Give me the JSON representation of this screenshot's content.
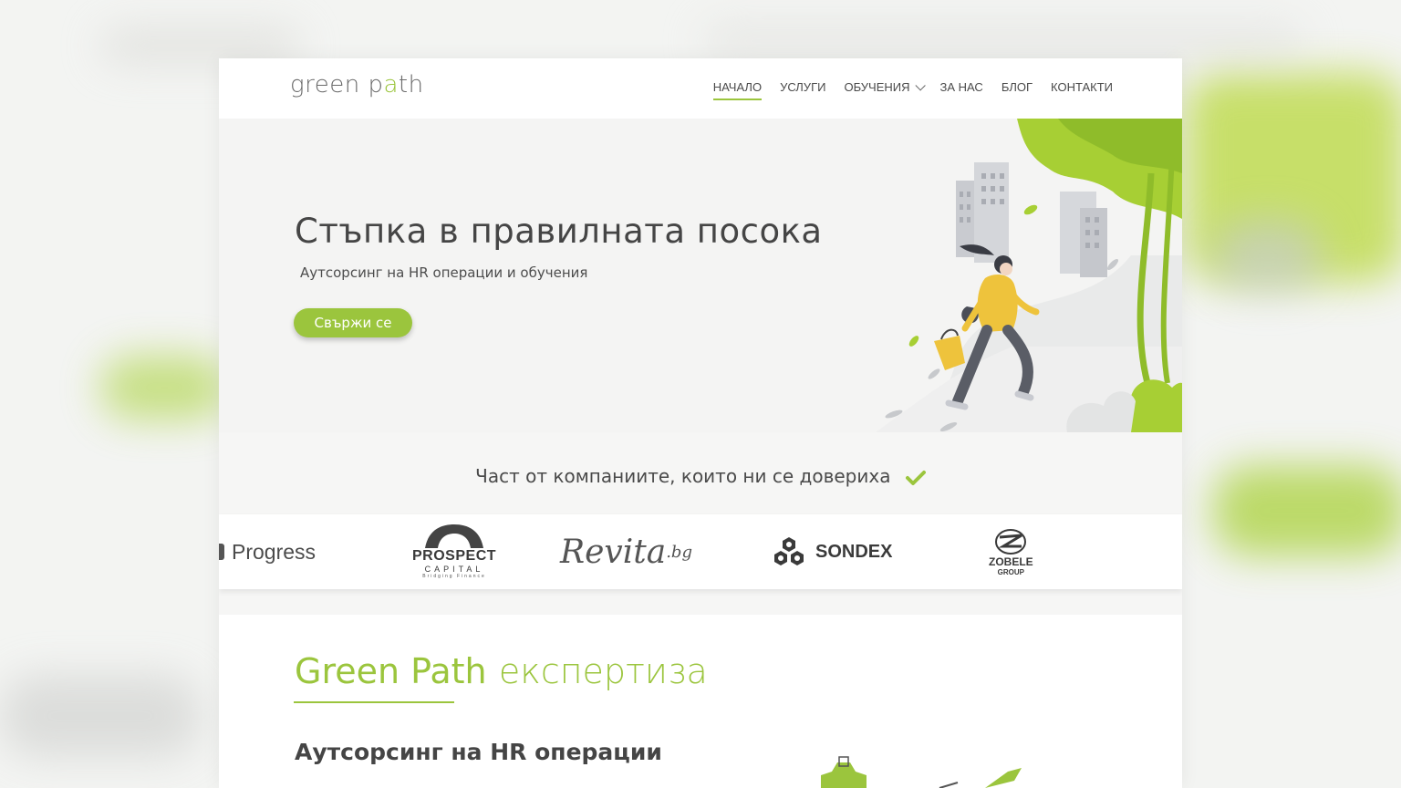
{
  "brand": {
    "logo_prefix": "green p",
    "logo_accent": "a",
    "logo_suffix": "th",
    "accent_color": "#9bc53d"
  },
  "nav": {
    "items": [
      {
        "label": "НАЧАЛО",
        "active": true
      },
      {
        "label": "УСЛУГИ",
        "active": false
      },
      {
        "label": "ОБУЧЕНИЯ",
        "active": false,
        "icon": "chevron-down-icon"
      },
      {
        "label": "ЗА НАС",
        "active": false
      },
      {
        "label": "БЛОГ",
        "active": false
      },
      {
        "label": "КОНТАКТИ",
        "active": false
      }
    ]
  },
  "hero": {
    "title": "Стъпка в правилната посока",
    "subtitle": "Аутсорсинг на HR операции и обучения",
    "cta_label": "Свържи се"
  },
  "trusted": {
    "heading": "Част от компаниите, които ни се довериха",
    "icon": "check-icon"
  },
  "client_logos": {
    "progress": "Progress",
    "prospect_line1": "PROSPECT",
    "prospect_line2": "CAPITAL",
    "prospect_line3": "Bridging Finance",
    "revita": "Revita",
    "revita_suffix": ".bg",
    "sondex": "SONDEX",
    "zobele_line1": "ZOBELE",
    "zobele_line2": "GROUP"
  },
  "expertise": {
    "title_green": "Green Path",
    "title_rest": "експертиза",
    "subtitle": "Аутсорсинг на HR операции"
  }
}
